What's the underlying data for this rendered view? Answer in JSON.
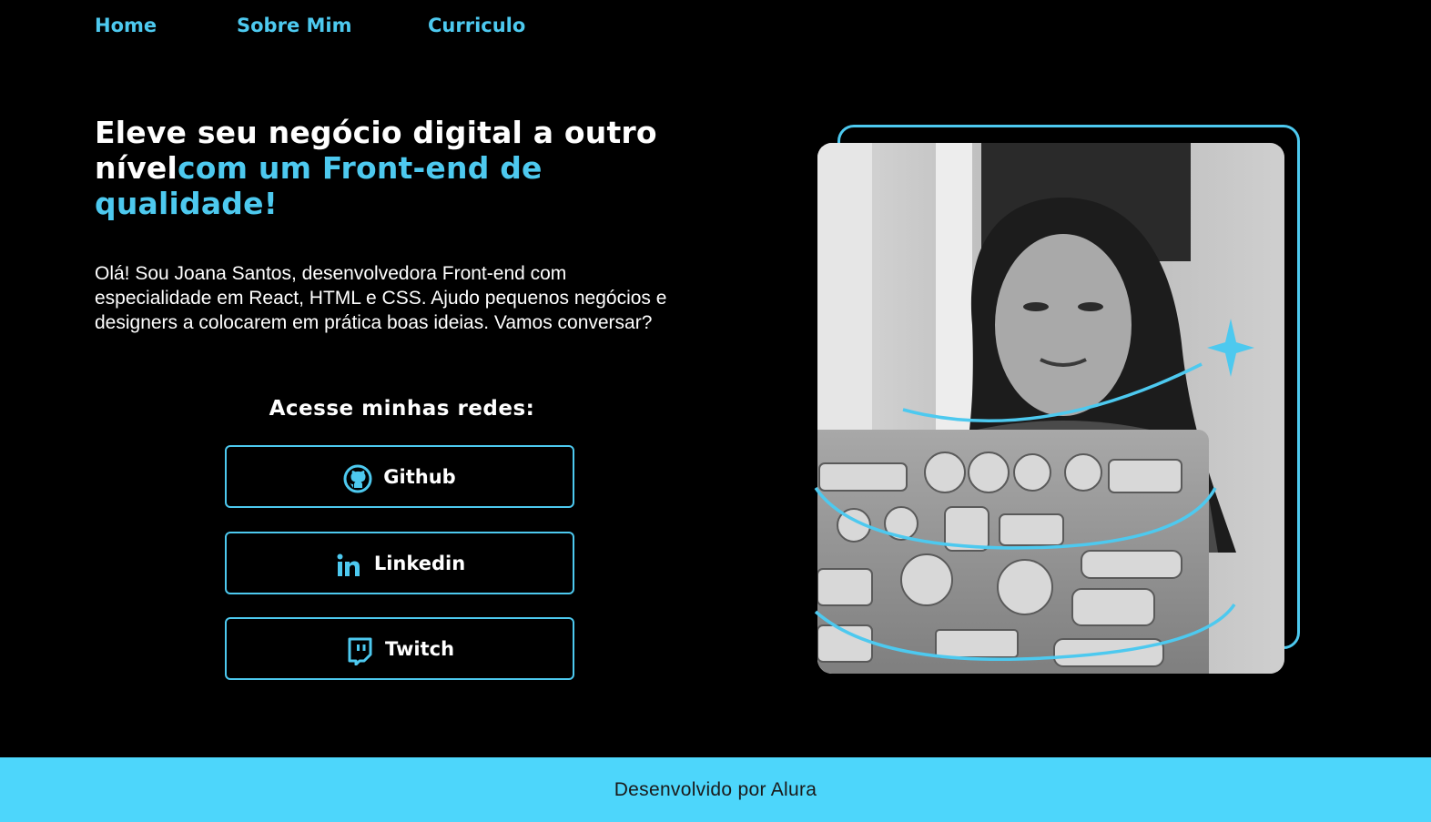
{
  "nav": {
    "items": [
      {
        "label": "Home"
      },
      {
        "label": "Sobre Mim"
      },
      {
        "label": "Curriculo"
      }
    ]
  },
  "hero": {
    "title_white": "Eleve seu negócio digital a outro nível",
    "title_accent": "com um Front-end de qualidade!",
    "description": "Olá! Sou Joana Santos, desenvolvedora Front-end com especialidade em React, HTML e CSS. Ajudo pequenos negócios e designers a colocarem em prática boas ideias. Vamos conversar?"
  },
  "social": {
    "title": "Acesse minhas redes:",
    "links": [
      {
        "label": "Github",
        "icon": "github-icon"
      },
      {
        "label": "Linkedin",
        "icon": "linkedin-icon"
      },
      {
        "label": "Twitch",
        "icon": "twitch-icon"
      }
    ]
  },
  "footer": {
    "text": "Desenvolvido por Alura"
  },
  "colors": {
    "background": "#000000",
    "accent": "#4dc9ef",
    "footer_bg": "#4dd6fb",
    "text": "#ffffff"
  }
}
